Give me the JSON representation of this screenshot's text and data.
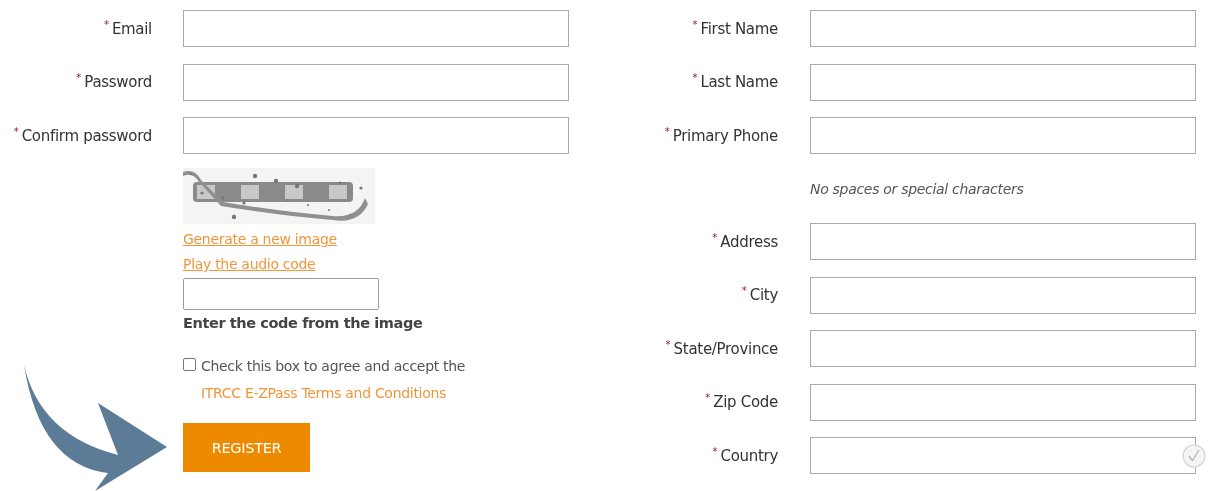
{
  "left_fields": [
    {
      "label": "Email",
      "mark": "*"
    },
    {
      "label": "Password",
      "mark": "*"
    },
    {
      "label": "Confirm password",
      "mark": "*"
    }
  ],
  "captcha": {
    "kind": "picture",
    "links": [
      "Generate a new image",
      "Play the audio code"
    ],
    "code_hint": "Enter the code from the image"
  },
  "agreement": {
    "checked": false,
    "text": "Check this box to agree and accept the",
    "link": "ITRCC E-ZPass Terms and Conditions"
  },
  "register_button": "REGISTER",
  "right_fields": [
    {
      "kind": "field",
      "label": "First Name",
      "mark": "*",
      "validated": false
    },
    {
      "kind": "field",
      "label": "Last Name",
      "mark": "*",
      "validated": false
    },
    {
      "kind": "field",
      "label": "Primary Phone",
      "mark": "*",
      "validated": false
    },
    {
      "kind": "hint",
      "text": "No spaces or special characters"
    },
    {
      "kind": "field",
      "label": "Address",
      "mark": "*",
      "validated": false
    },
    {
      "kind": "field",
      "label": "City",
      "mark": "*",
      "validated": false
    },
    {
      "kind": "field",
      "label": "State/Province",
      "mark": "*",
      "validated": false
    },
    {
      "kind": "field",
      "label": "Zip Code",
      "mark": "*",
      "validated": false
    },
    {
      "kind": "field",
      "label": "Country",
      "mark": "*",
      "validated": true
    }
  ]
}
